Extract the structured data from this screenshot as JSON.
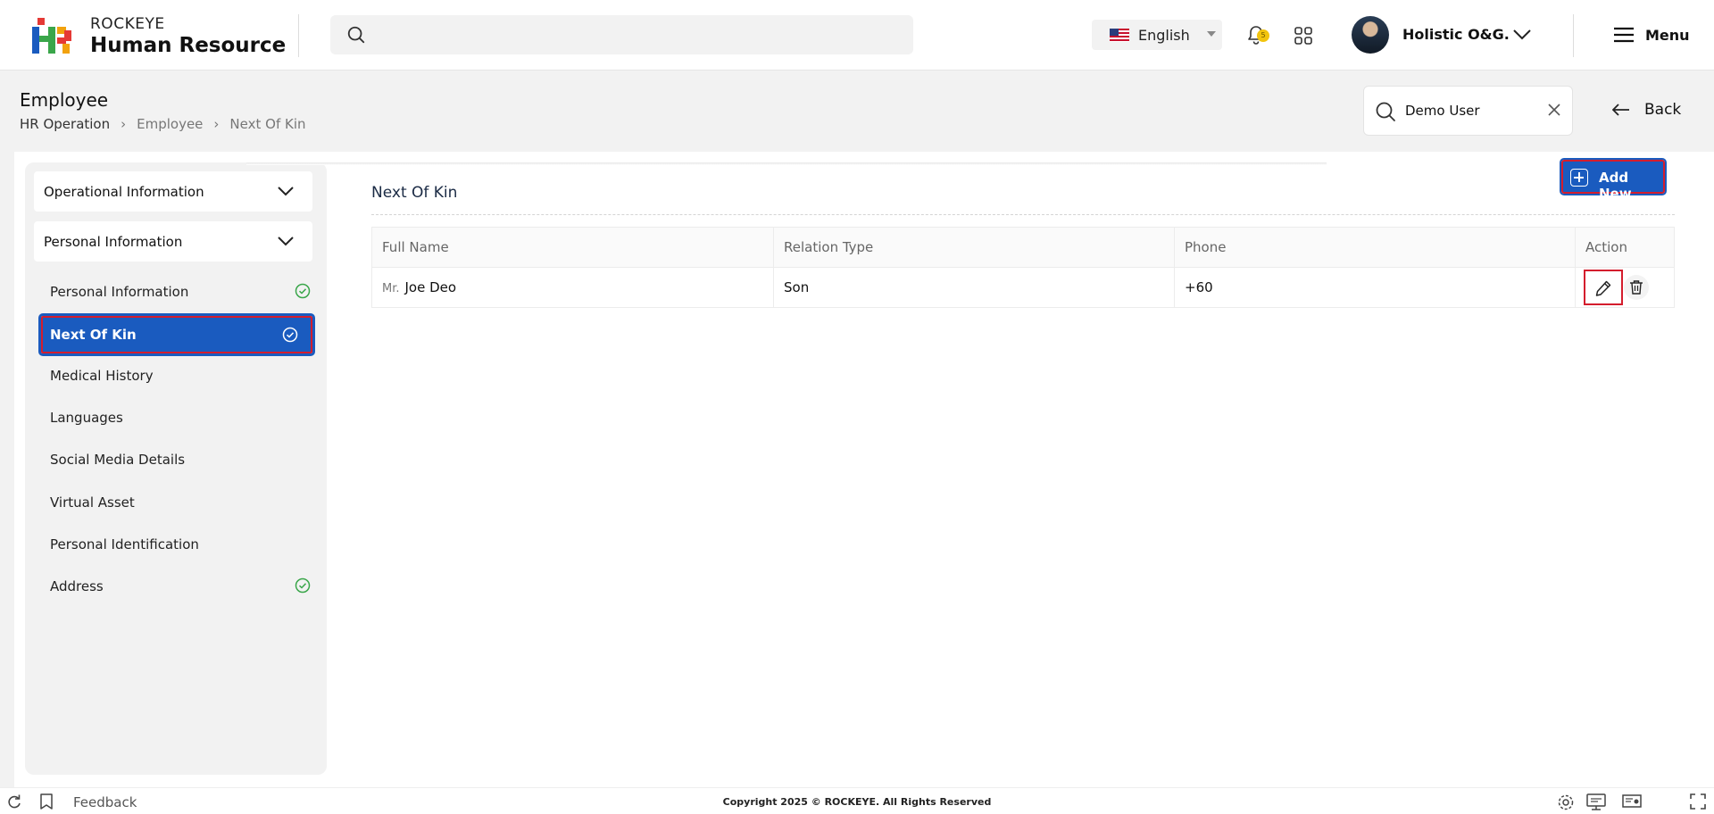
{
  "brand": {
    "line1": "ROCKEYE",
    "line2": "Human Resource"
  },
  "header": {
    "language": "English",
    "notification_count": "5",
    "user_name": "Holistic O&G.",
    "menu_label": "Menu"
  },
  "page": {
    "title": "Employee",
    "breadcrumb": [
      "HR Operation",
      "Employee",
      "Next Of Kin"
    ],
    "employee_search": "Demo User",
    "back_label": "Back"
  },
  "sidebar": {
    "sections": [
      {
        "label": "Operational Information"
      },
      {
        "label": "Personal Information"
      }
    ],
    "items": [
      {
        "label": "Personal Information",
        "complete": true
      },
      {
        "label": "Next Of Kin",
        "complete": true,
        "active": true
      },
      {
        "label": "Medical History",
        "complete": false
      },
      {
        "label": "Languages",
        "complete": false
      },
      {
        "label": "Social Media Details",
        "complete": false
      },
      {
        "label": "Virtual Asset",
        "complete": false
      },
      {
        "label": "Personal Identification",
        "complete": false
      },
      {
        "label": "Address",
        "complete": true
      }
    ]
  },
  "main": {
    "section_title": "Next Of Kin",
    "add_button": "Add New",
    "table": {
      "columns": [
        "Full Name",
        "Relation Type",
        "Phone",
        "Action"
      ],
      "rows": [
        {
          "title": "Mr.",
          "name": "Joe Deo",
          "relation": "Son",
          "phone": "+60"
        }
      ]
    }
  },
  "footer": {
    "feedback": "Feedback",
    "copyright": "Copyright 2025 © ROCKEYE. All Rights Reserved"
  },
  "colors": {
    "primary": "#1a5bbf",
    "highlight": "#d41d2d",
    "check": "#3aa64a"
  }
}
